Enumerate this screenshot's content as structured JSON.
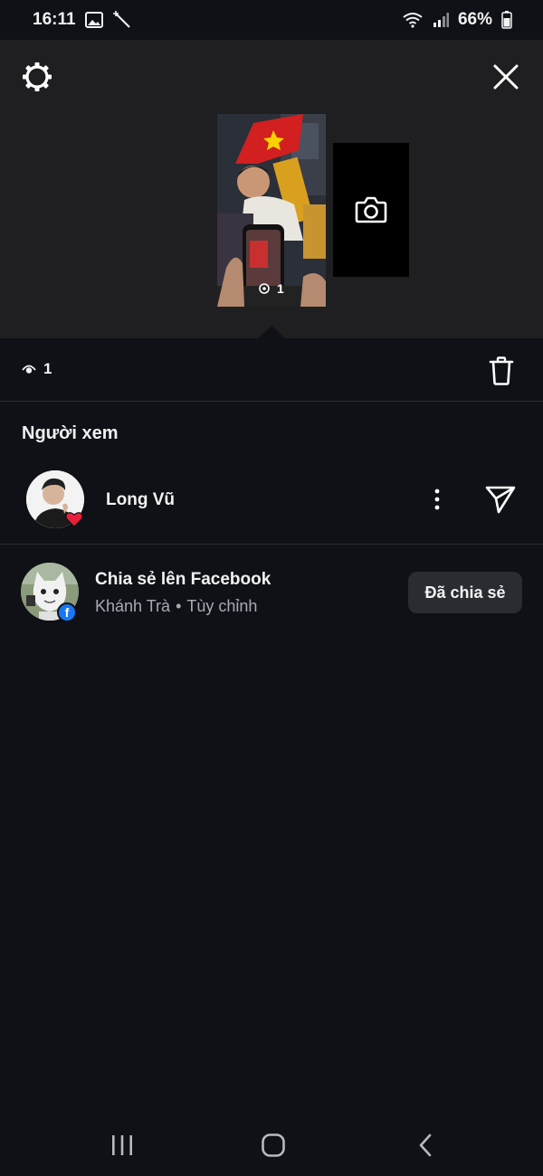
{
  "status_bar": {
    "time": "16:11",
    "battery": "66%",
    "icons": [
      "gallery-icon",
      "magic-wand-icon",
      "wifi-icon",
      "signal-icon",
      "battery-icon"
    ]
  },
  "story": {
    "thumbnail_view_count": "1",
    "add_story_icon": "camera-icon"
  },
  "stats": {
    "views": "1"
  },
  "viewers_section": {
    "title": "Người xem",
    "viewers": [
      {
        "name": "Long Vũ",
        "reaction": "heart"
      }
    ]
  },
  "share": {
    "title": "Chia sẻ lên Facebook",
    "account": "Khánh Trà",
    "separator": "•",
    "audience": "Tùy chỉnh",
    "button_label": "Đã chia sẻ"
  },
  "colors": {
    "background": "#0f1117",
    "panel": "#1f1f21",
    "button": "#2a2c31",
    "facebook_blue": "#1877f2",
    "heart_red": "#e8203a"
  }
}
